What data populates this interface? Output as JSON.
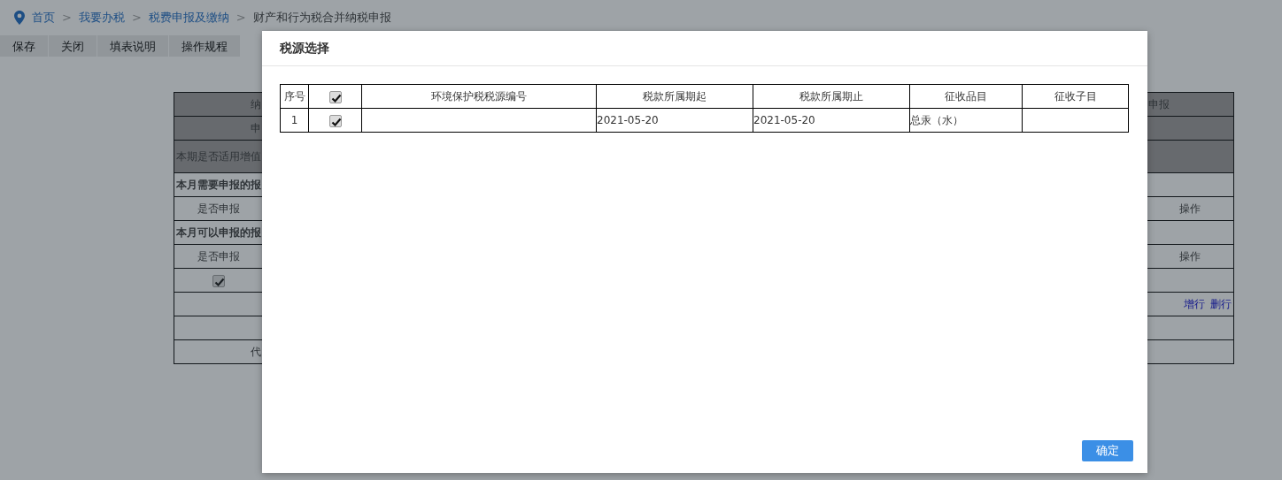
{
  "breadcrumb": [
    {
      "label": "首页",
      "kind": "link"
    },
    {
      "label": "我要办税",
      "kind": "link"
    },
    {
      "label": "税费申报及缴纳",
      "kind": "link"
    },
    {
      "label": "财产和行为税合并纳税申报",
      "kind": "current"
    }
  ],
  "breadcrumb_separator": ">",
  "toolbar": [
    "保存",
    "关闭",
    "填表说明",
    "操作规程"
  ],
  "form_rows": [
    {
      "kind": "field",
      "left": "纳",
      "right": "申报",
      "readonly": true
    },
    {
      "kind": "field",
      "left": "申",
      "readonly": true
    },
    {
      "kind": "question",
      "left": "本期是否适用增值",
      "readonly": true
    },
    {
      "kind": "section",
      "left": "本月需要申报的报",
      "readonly": false
    },
    {
      "kind": "header",
      "left": "是否申报",
      "right": "操作",
      "readonly": false
    },
    {
      "kind": "section",
      "left": "本月可以申报的报",
      "readonly": false
    },
    {
      "kind": "header",
      "left": "是否申报",
      "right": "操作",
      "readonly": false
    },
    {
      "kind": "checkbox",
      "checked": true,
      "readonly": false
    },
    {
      "kind": "actions",
      "links": [
        "增行",
        "删行"
      ],
      "readonly": false
    },
    {
      "kind": "field",
      "readonly": false
    },
    {
      "kind": "field",
      "left": "代",
      "readonly": false
    }
  ],
  "modal": {
    "title": "税源选择",
    "columns": [
      "序号",
      "",
      "环境保护税税源编号",
      "税款所属期起",
      "税款所属期止",
      "征收品目",
      "征收子目"
    ],
    "header_checked": true,
    "rows": [
      {
        "checked": true,
        "cells": [
          "1",
          "",
          "",
          "2021-05-20",
          "2021-05-20",
          "总汞（水）",
          ""
        ]
      }
    ],
    "confirm_button": "确定"
  }
}
